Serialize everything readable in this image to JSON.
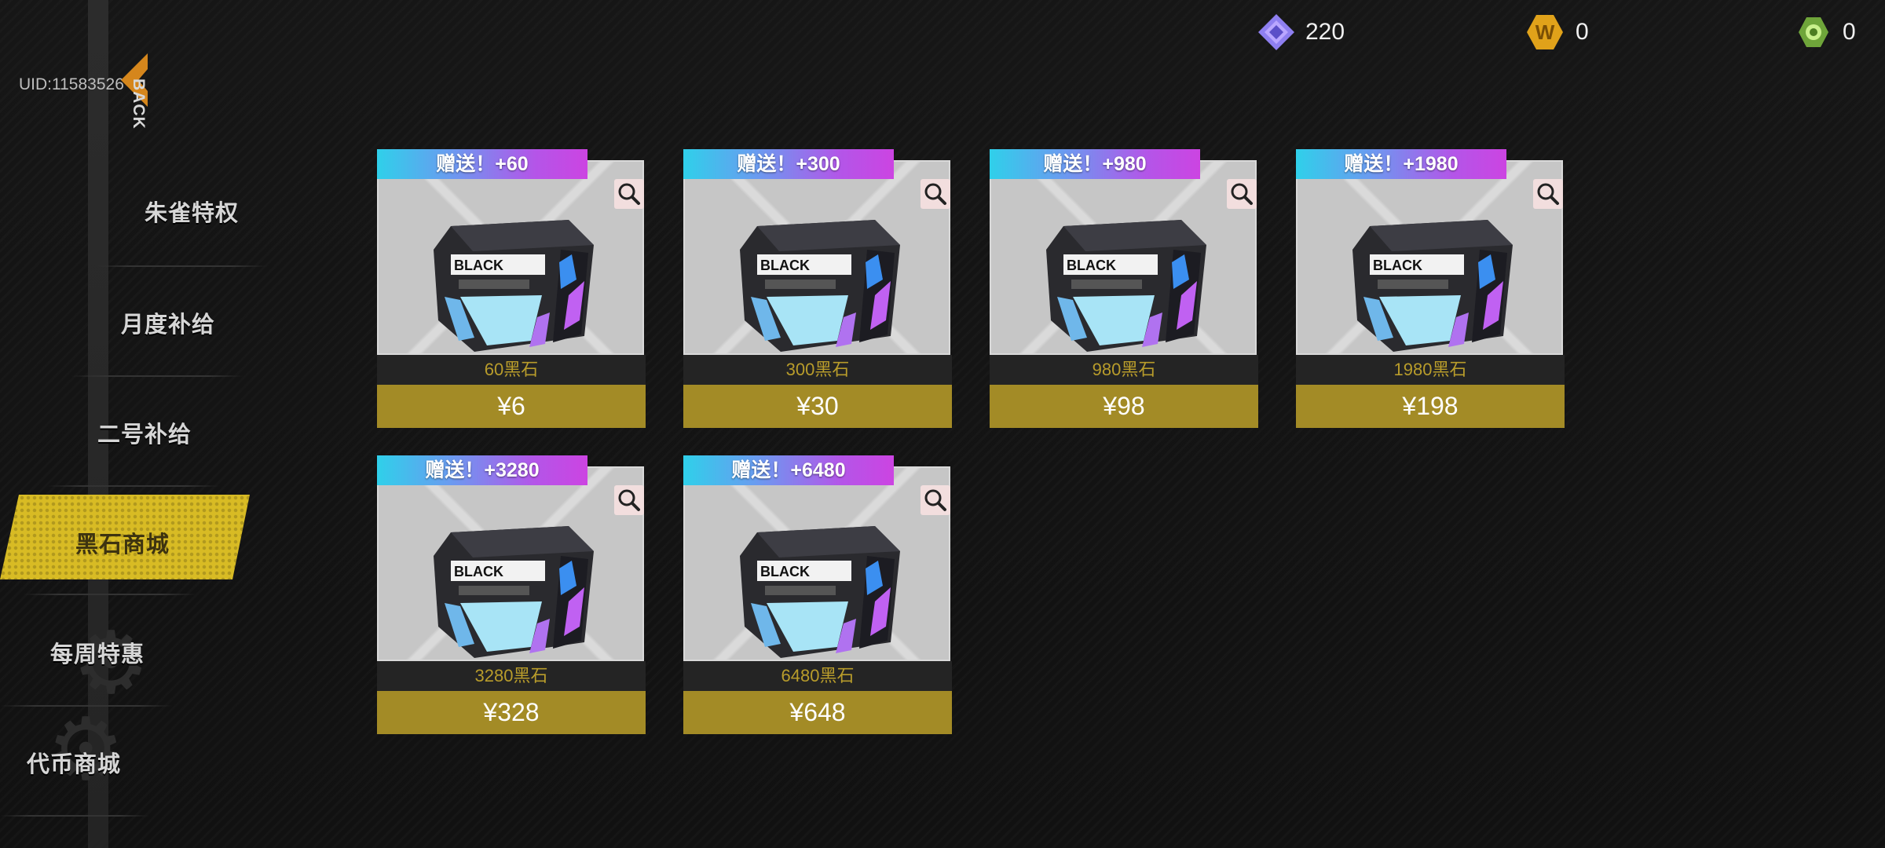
{
  "header": {
    "uid": "UID:11583526",
    "back_label": "BACK",
    "currencies": [
      {
        "icon": "diamond-icon",
        "value": "220"
      },
      {
        "icon": "w-coin-icon",
        "value": "0"
      },
      {
        "icon": "gear-token-icon",
        "value": "0"
      }
    ]
  },
  "sidebar": {
    "items": [
      {
        "label": "朱雀特权",
        "active": false
      },
      {
        "label": "月度补给",
        "active": false
      },
      {
        "label": "二号补给",
        "active": false
      },
      {
        "label": "黑石商城",
        "active": true
      },
      {
        "label": "每周特惠",
        "active": false
      },
      {
        "label": "代币商城",
        "active": false
      }
    ]
  },
  "shop": {
    "items": [
      {
        "bonus": "赠送！+60",
        "name": "60黑石",
        "price": "¥6"
      },
      {
        "bonus": "赠送！+300",
        "name": "300黑石",
        "price": "¥30"
      },
      {
        "bonus": "赠送！+980",
        "name": "980黑石",
        "price": "¥98"
      },
      {
        "bonus": "赠送！+1980",
        "name": "1980黑石",
        "price": "¥198"
      },
      {
        "bonus": "赠送！+3280",
        "name": "3280黑石",
        "price": "¥328"
      },
      {
        "bonus": "赠送！+6480",
        "name": "6480黑石",
        "price": "¥648"
      }
    ]
  },
  "colors": {
    "accent": "#d8bb24",
    "price_bg": "#a38b26",
    "name_text": "#b89c2b"
  }
}
